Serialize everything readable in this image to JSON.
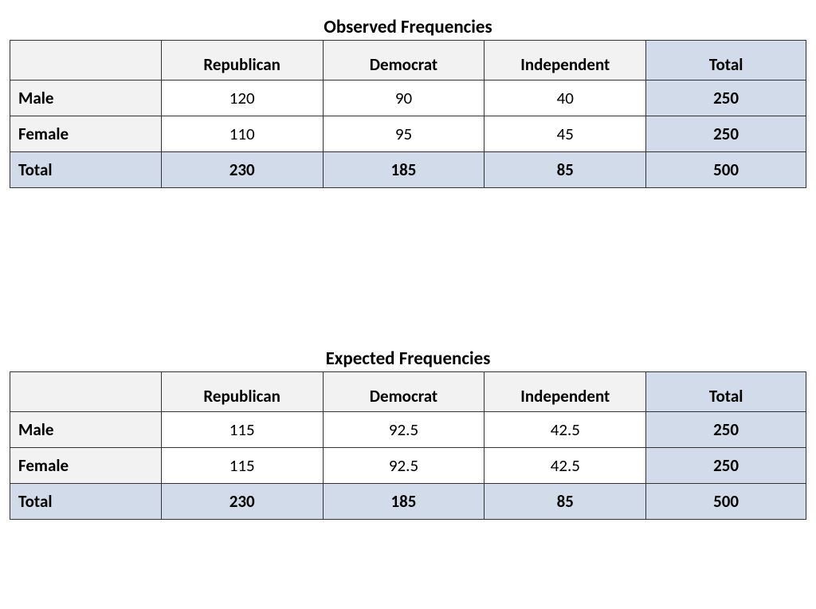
{
  "chart_data": [
    {
      "type": "table",
      "title": "Observed Frequencies",
      "columns": [
        "Republican",
        "Democrat",
        "Independent",
        "Total"
      ],
      "rows": [
        {
          "label": "Male",
          "values": [
            120,
            90,
            40,
            250
          ]
        },
        {
          "label": "Female",
          "values": [
            110,
            95,
            45,
            250
          ]
        },
        {
          "label": "Total",
          "values": [
            230,
            185,
            85,
            500
          ]
        }
      ]
    },
    {
      "type": "table",
      "title": "Expected Frequencies",
      "columns": [
        "Republican",
        "Democrat",
        "Independent",
        "Total"
      ],
      "rows": [
        {
          "label": "Male",
          "values": [
            115,
            92.5,
            42.5,
            250
          ]
        },
        {
          "label": "Female",
          "values": [
            115,
            92.5,
            42.5,
            250
          ]
        },
        {
          "label": "Total",
          "values": [
            230,
            185,
            85,
            500
          ]
        }
      ]
    }
  ]
}
